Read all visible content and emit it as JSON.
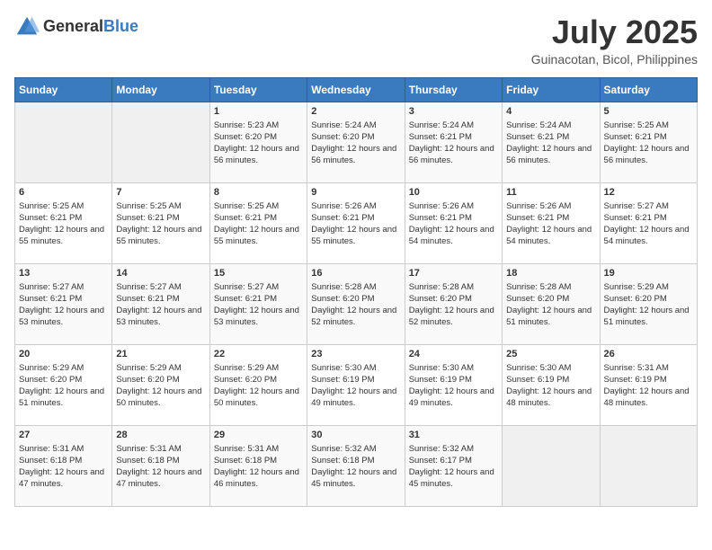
{
  "logo": {
    "text_general": "General",
    "text_blue": "Blue"
  },
  "header": {
    "month": "July 2025",
    "location": "Guinacotan, Bicol, Philippines"
  },
  "weekdays": [
    "Sunday",
    "Monday",
    "Tuesday",
    "Wednesday",
    "Thursday",
    "Friday",
    "Saturday"
  ],
  "weeks": [
    [
      {
        "day": "",
        "sunrise": "",
        "sunset": "",
        "daylight": ""
      },
      {
        "day": "",
        "sunrise": "",
        "sunset": "",
        "daylight": ""
      },
      {
        "day": "1",
        "sunrise": "Sunrise: 5:23 AM",
        "sunset": "Sunset: 6:20 PM",
        "daylight": "Daylight: 12 hours and 56 minutes."
      },
      {
        "day": "2",
        "sunrise": "Sunrise: 5:24 AM",
        "sunset": "Sunset: 6:20 PM",
        "daylight": "Daylight: 12 hours and 56 minutes."
      },
      {
        "day": "3",
        "sunrise": "Sunrise: 5:24 AM",
        "sunset": "Sunset: 6:21 PM",
        "daylight": "Daylight: 12 hours and 56 minutes."
      },
      {
        "day": "4",
        "sunrise": "Sunrise: 5:24 AM",
        "sunset": "Sunset: 6:21 PM",
        "daylight": "Daylight: 12 hours and 56 minutes."
      },
      {
        "day": "5",
        "sunrise": "Sunrise: 5:25 AM",
        "sunset": "Sunset: 6:21 PM",
        "daylight": "Daylight: 12 hours and 56 minutes."
      }
    ],
    [
      {
        "day": "6",
        "sunrise": "Sunrise: 5:25 AM",
        "sunset": "Sunset: 6:21 PM",
        "daylight": "Daylight: 12 hours and 55 minutes."
      },
      {
        "day": "7",
        "sunrise": "Sunrise: 5:25 AM",
        "sunset": "Sunset: 6:21 PM",
        "daylight": "Daylight: 12 hours and 55 minutes."
      },
      {
        "day": "8",
        "sunrise": "Sunrise: 5:25 AM",
        "sunset": "Sunset: 6:21 PM",
        "daylight": "Daylight: 12 hours and 55 minutes."
      },
      {
        "day": "9",
        "sunrise": "Sunrise: 5:26 AM",
        "sunset": "Sunset: 6:21 PM",
        "daylight": "Daylight: 12 hours and 55 minutes."
      },
      {
        "day": "10",
        "sunrise": "Sunrise: 5:26 AM",
        "sunset": "Sunset: 6:21 PM",
        "daylight": "Daylight: 12 hours and 54 minutes."
      },
      {
        "day": "11",
        "sunrise": "Sunrise: 5:26 AM",
        "sunset": "Sunset: 6:21 PM",
        "daylight": "Daylight: 12 hours and 54 minutes."
      },
      {
        "day": "12",
        "sunrise": "Sunrise: 5:27 AM",
        "sunset": "Sunset: 6:21 PM",
        "daylight": "Daylight: 12 hours and 54 minutes."
      }
    ],
    [
      {
        "day": "13",
        "sunrise": "Sunrise: 5:27 AM",
        "sunset": "Sunset: 6:21 PM",
        "daylight": "Daylight: 12 hours and 53 minutes."
      },
      {
        "day": "14",
        "sunrise": "Sunrise: 5:27 AM",
        "sunset": "Sunset: 6:21 PM",
        "daylight": "Daylight: 12 hours and 53 minutes."
      },
      {
        "day": "15",
        "sunrise": "Sunrise: 5:27 AM",
        "sunset": "Sunset: 6:21 PM",
        "daylight": "Daylight: 12 hours and 53 minutes."
      },
      {
        "day": "16",
        "sunrise": "Sunrise: 5:28 AM",
        "sunset": "Sunset: 6:20 PM",
        "daylight": "Daylight: 12 hours and 52 minutes."
      },
      {
        "day": "17",
        "sunrise": "Sunrise: 5:28 AM",
        "sunset": "Sunset: 6:20 PM",
        "daylight": "Daylight: 12 hours and 52 minutes."
      },
      {
        "day": "18",
        "sunrise": "Sunrise: 5:28 AM",
        "sunset": "Sunset: 6:20 PM",
        "daylight": "Daylight: 12 hours and 51 minutes."
      },
      {
        "day": "19",
        "sunrise": "Sunrise: 5:29 AM",
        "sunset": "Sunset: 6:20 PM",
        "daylight": "Daylight: 12 hours and 51 minutes."
      }
    ],
    [
      {
        "day": "20",
        "sunrise": "Sunrise: 5:29 AM",
        "sunset": "Sunset: 6:20 PM",
        "daylight": "Daylight: 12 hours and 51 minutes."
      },
      {
        "day": "21",
        "sunrise": "Sunrise: 5:29 AM",
        "sunset": "Sunset: 6:20 PM",
        "daylight": "Daylight: 12 hours and 50 minutes."
      },
      {
        "day": "22",
        "sunrise": "Sunrise: 5:29 AM",
        "sunset": "Sunset: 6:20 PM",
        "daylight": "Daylight: 12 hours and 50 minutes."
      },
      {
        "day": "23",
        "sunrise": "Sunrise: 5:30 AM",
        "sunset": "Sunset: 6:19 PM",
        "daylight": "Daylight: 12 hours and 49 minutes."
      },
      {
        "day": "24",
        "sunrise": "Sunrise: 5:30 AM",
        "sunset": "Sunset: 6:19 PM",
        "daylight": "Daylight: 12 hours and 49 minutes."
      },
      {
        "day": "25",
        "sunrise": "Sunrise: 5:30 AM",
        "sunset": "Sunset: 6:19 PM",
        "daylight": "Daylight: 12 hours and 48 minutes."
      },
      {
        "day": "26",
        "sunrise": "Sunrise: 5:31 AM",
        "sunset": "Sunset: 6:19 PM",
        "daylight": "Daylight: 12 hours and 48 minutes."
      }
    ],
    [
      {
        "day": "27",
        "sunrise": "Sunrise: 5:31 AM",
        "sunset": "Sunset: 6:18 PM",
        "daylight": "Daylight: 12 hours and 47 minutes."
      },
      {
        "day": "28",
        "sunrise": "Sunrise: 5:31 AM",
        "sunset": "Sunset: 6:18 PM",
        "daylight": "Daylight: 12 hours and 47 minutes."
      },
      {
        "day": "29",
        "sunrise": "Sunrise: 5:31 AM",
        "sunset": "Sunset: 6:18 PM",
        "daylight": "Daylight: 12 hours and 46 minutes."
      },
      {
        "day": "30",
        "sunrise": "Sunrise: 5:32 AM",
        "sunset": "Sunset: 6:18 PM",
        "daylight": "Daylight: 12 hours and 45 minutes."
      },
      {
        "day": "31",
        "sunrise": "Sunrise: 5:32 AM",
        "sunset": "Sunset: 6:17 PM",
        "daylight": "Daylight: 12 hours and 45 minutes."
      },
      {
        "day": "",
        "sunrise": "",
        "sunset": "",
        "daylight": ""
      },
      {
        "day": "",
        "sunrise": "",
        "sunset": "",
        "daylight": ""
      }
    ]
  ]
}
